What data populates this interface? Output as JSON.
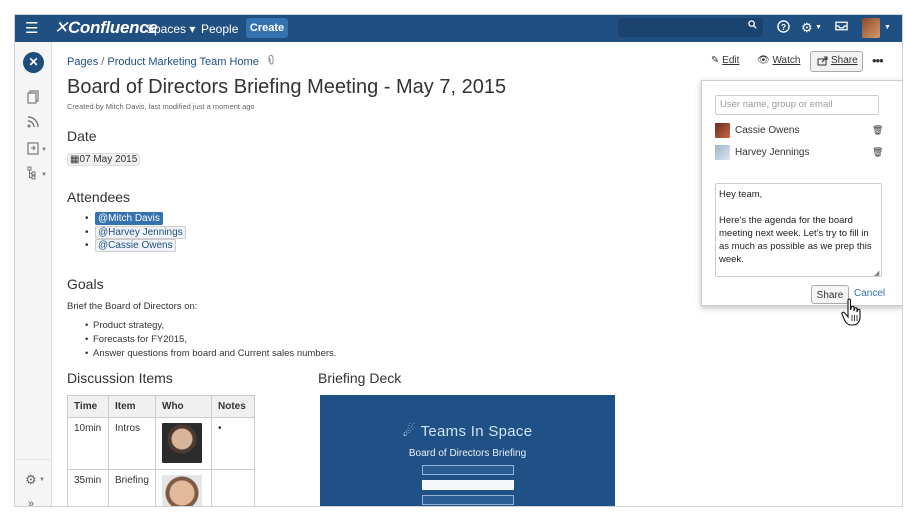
{
  "topnav": {
    "menu_icon": "hamburger-icon",
    "logo": "Confluence",
    "spaces": "Spaces ▾",
    "people": "People",
    "create": "Create",
    "icons": [
      "search-icon",
      "help-icon",
      "gear-icon",
      "notifications-icon",
      "user-avatar"
    ]
  },
  "sidebar": {
    "space_logo": "✕",
    "icons": [
      "pages-icon",
      "blog-icon",
      "shortcuts-icon",
      "tree-icon",
      "settings-icon",
      "collapse-icon"
    ]
  },
  "breadcrumb": {
    "pages": "Pages",
    "separator": "/",
    "parent": "Product Marketing Team Home"
  },
  "page": {
    "title": "Board of Directors Briefing Meeting - May 7, 2015",
    "byline": "Created by Mitch Davis, last modified just a moment ago"
  },
  "sections": {
    "date": {
      "heading": "Date",
      "value": "07 May 2015"
    },
    "attendees": {
      "heading": "Attendees",
      "items": [
        "@Mitch Davis",
        "@Harvey Jennings",
        "@Cassie Owens"
      ]
    },
    "goals": {
      "heading": "Goals",
      "intro": "Brief the Board of Directors on:",
      "items": [
        "Product strategy,",
        "Forecasts for FY2015,",
        "Answer questions from board and Current sales numbers."
      ]
    },
    "discussion": {
      "heading": "Discussion Items",
      "columns": [
        "Time",
        "Item",
        "Who",
        "Notes"
      ],
      "rows": [
        {
          "time": "10min",
          "item": "Intros",
          "notes": "•"
        },
        {
          "time": "35min",
          "item": "Briefing",
          "notes": ""
        }
      ]
    },
    "deck": {
      "heading": "Briefing Deck",
      "brand": "Teams In Space",
      "subtitle": "Board of Directors Briefing"
    }
  },
  "actions": {
    "edit": "Edit",
    "watch": "Watch",
    "share": "Share",
    "more": "•••"
  },
  "share_dialog": {
    "placeholder": "User name, group or email",
    "users": [
      "Cassie Owens",
      "Harvey Jennings"
    ],
    "message": "Hey team,\n\nHere's the agenda for the board meeting next week. Let's try to fill in as much as possible as we prep this week.",
    "share_button": "Share",
    "cancel_link": "Cancel"
  }
}
